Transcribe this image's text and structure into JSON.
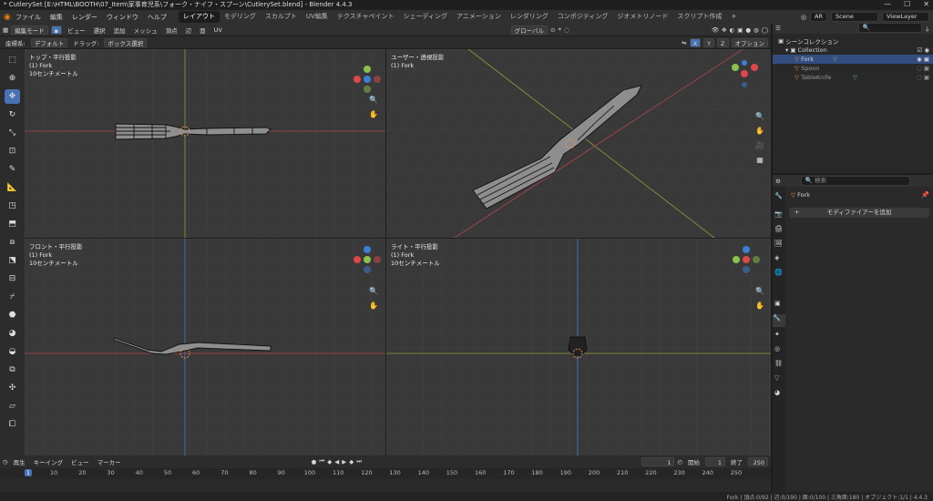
{
  "window": {
    "title": "* CutlerySet [E:\\HTML\\BOOTH\\07_Item\\家事育児系\\フォーク・ナイフ・スプーン\\CutlerySet.blend] - Blender 4.4.3"
  },
  "menu": [
    "ファイル",
    "編集",
    "レンダー",
    "ウィンドウ",
    "ヘルプ"
  ],
  "workspace_tabs": [
    "レイアウト",
    "モデリング",
    "スカルプト",
    "UV編集",
    "テクスチャペイント",
    "シェーディング",
    "アニメーション",
    "レンダリング",
    "コンポジティング",
    "ジオメトリノード",
    "スクリプト作成"
  ],
  "top_right": {
    "render_label": "AR",
    "scene": "Scene",
    "view_layer": "ViewLayer"
  },
  "viewport_header": {
    "mode": "編集モード",
    "menus": [
      "ビュー",
      "選択",
      "追加",
      "メッシュ",
      "頂点",
      "辺",
      "面",
      "UV"
    ],
    "transform": "グローバル",
    "options": "オプション"
  },
  "tool_header": {
    "coord_label": "座標系:",
    "coord_value": "デフォルト",
    "drag_label": "ドラッグ:",
    "drag_value": "ボックス選択"
  },
  "xyz": [
    "X",
    "Y",
    "Z"
  ],
  "viewports": [
    {
      "line1": "トップ・平行投影",
      "line2": "(1) Fork",
      "line3": "10センチメートル"
    },
    {
      "line1": "ユーザー・透視投影",
      "line2": "(1) Fork",
      "line3": ""
    },
    {
      "line1": "フロント・平行投影",
      "line2": "(1) Fork",
      "line3": "10センチメートル"
    },
    {
      "line1": "ライト・平行投影",
      "line2": "(1) Fork",
      "line3": "10センチメートル"
    }
  ],
  "outliner": {
    "scene_collection": "シーンコレクション",
    "collection": "Collection",
    "items": [
      "Fork",
      "Spoon",
      "TableKnife"
    ]
  },
  "properties": {
    "search_placeholder": "検索",
    "object_name": "Fork",
    "add_modifier": "モディファイアーを追加"
  },
  "timeline": {
    "playback": "再生",
    "keying": "キーイング",
    "view": "ビュー",
    "marker": "マーカー",
    "current_frame": "1",
    "start_label": "開始",
    "start": "1",
    "end_label": "終了",
    "end": "250",
    "ticks": [
      "1",
      "10",
      "20",
      "30",
      "40",
      "50",
      "60",
      "70",
      "80",
      "90",
      "100",
      "110",
      "120",
      "130",
      "140",
      "150",
      "160",
      "170",
      "180",
      "190",
      "200",
      "210",
      "220",
      "230",
      "240",
      "250"
    ]
  },
  "status": "Fork | 頂点:0/92 | 辺:0/190 | 面:0/100 | 三角面:180 | オブジェクト:1/1 | 4.4.3",
  "colors": {
    "accent": "#4772b3",
    "x_axis": "#e0474a",
    "y_axis": "#8bc34a",
    "z_axis": "#3c7fd6"
  }
}
